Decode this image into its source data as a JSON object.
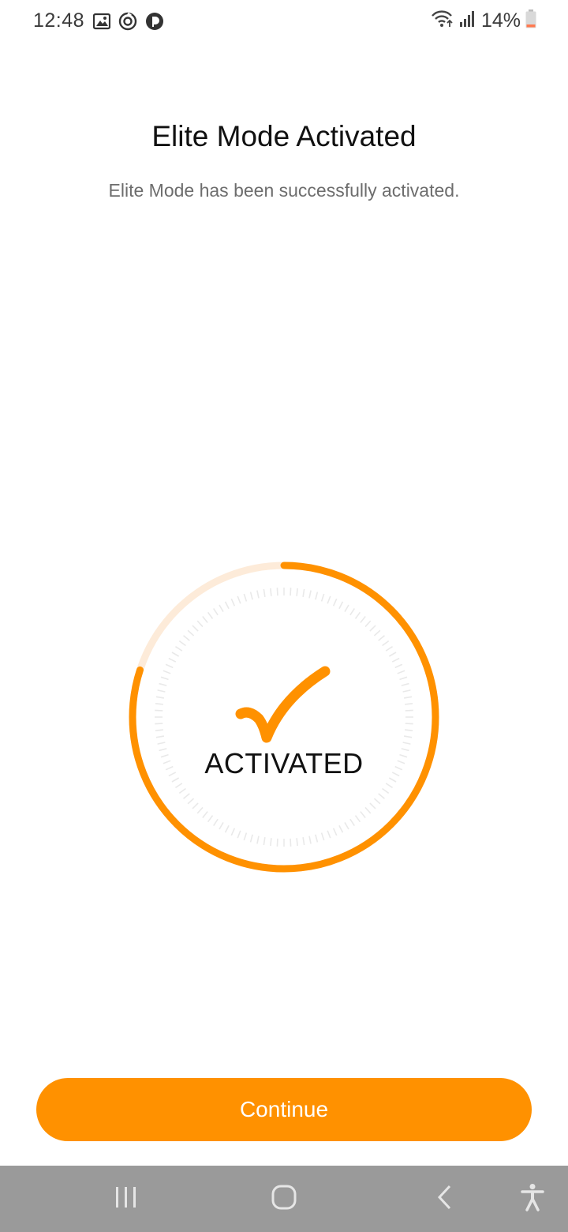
{
  "status_bar": {
    "time": "12:48",
    "battery": "14%",
    "left_icons": [
      "gallery-icon",
      "sync-icon",
      "app-notification-icon"
    ],
    "right_icons": [
      "wifi-icon",
      "signal-icon",
      "battery-icon"
    ]
  },
  "header": {
    "title": "Elite Mode Activated",
    "subtitle": "Elite Mode has been successfully activated."
  },
  "status_ring": {
    "label": "ACTIVATED",
    "progress": 0.8,
    "icon": "checkmark-icon",
    "colors": {
      "accent": "#ff9100",
      "track": "#fdebd9",
      "ticks": "#e9e9e9"
    }
  },
  "actions": {
    "continue_label": "Continue",
    "button_color": "#ff9100"
  },
  "nav_bar": {
    "buttons": [
      "recent-apps-icon",
      "home-icon",
      "back-icon",
      "accessibility-icon"
    ]
  }
}
